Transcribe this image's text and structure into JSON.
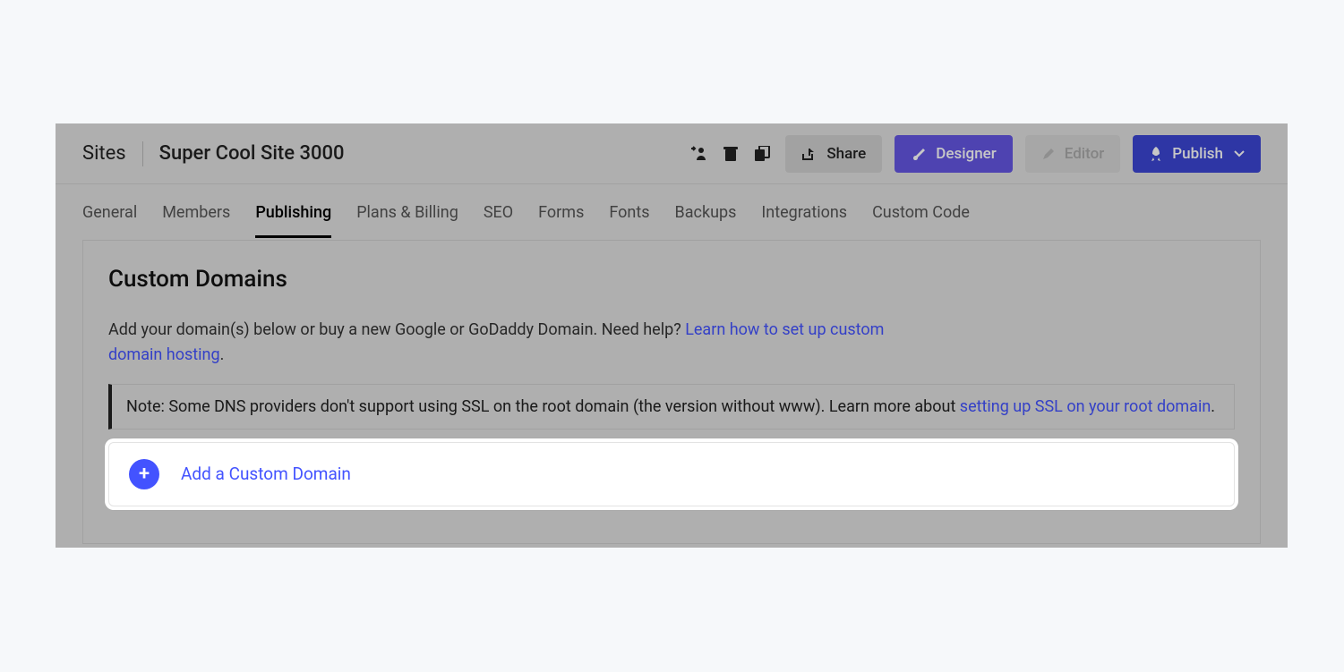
{
  "breadcrumb": {
    "root": "Sites",
    "site_name": "Super Cool Site 3000"
  },
  "top_actions": {
    "share": "Share",
    "designer": "Designer",
    "editor": "Editor",
    "publish": "Publish"
  },
  "tabs": [
    "General",
    "Members",
    "Publishing",
    "Plans & Billing",
    "SEO",
    "Forms",
    "Fonts",
    "Backups",
    "Integrations",
    "Custom Code"
  ],
  "active_tab_index": 2,
  "panel": {
    "heading": "Custom Domains",
    "desc_pre": "Add your domain(s) below or buy a new Google or GoDaddy Domain. Need help? ",
    "desc_link": "Learn how to set up custom domain hosting",
    "desc_post": ".",
    "note_pre": "Note: Some DNS providers don't support using SSL on the root domain (the version without www). Learn more about ",
    "note_link": "setting up SSL on your root domain",
    "note_post": ".",
    "add_label": "Add a Custom Domain"
  },
  "icons": {
    "transfer": "transfer-user-icon",
    "trash": "trash-icon",
    "copy": "copy-icon",
    "share": "share-icon",
    "brush": "brush-icon",
    "pen": "pen-icon",
    "rocket": "rocket-icon",
    "chevron_down": "chevron-down-icon",
    "plus": "plus-icon"
  },
  "colors": {
    "accent": "#4353ff",
    "designer_btn": "#6457e3",
    "publish_btn": "#3b46d4"
  }
}
